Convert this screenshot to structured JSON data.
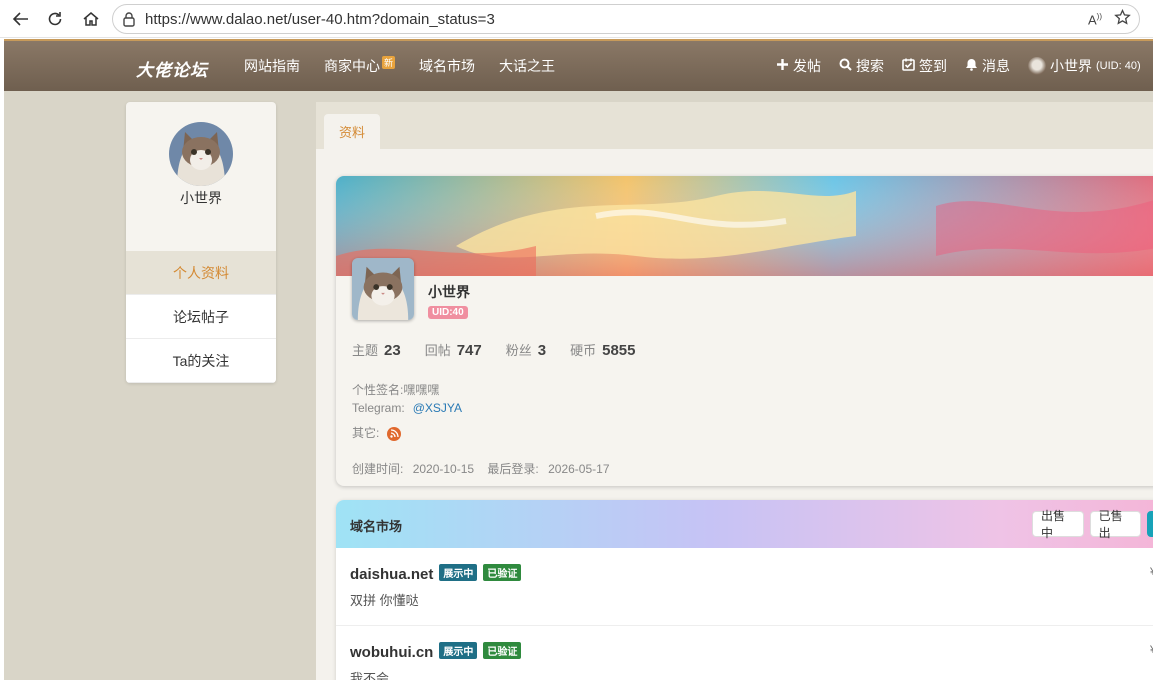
{
  "browser": {
    "url": "https://www.dalao.net/user-40.htm?domain_status=3"
  },
  "site": {
    "logo": "大佬论坛",
    "nav": [
      {
        "label": "网站指南"
      },
      {
        "label": "商家中心",
        "badge": "新"
      },
      {
        "label": "域名市场"
      },
      {
        "label": "大话之王"
      }
    ],
    "actions": {
      "post": "发帖",
      "search": "搜索",
      "checkin": "签到",
      "messages": "消息",
      "user_name": "小世界",
      "user_uid": "(UID: 40)"
    }
  },
  "sidebar": {
    "name": "小世界",
    "menu": [
      {
        "label": "个人资料",
        "active": true
      },
      {
        "label": "论坛帖子",
        "active": false
      },
      {
        "label": "Ta的关注",
        "active": false
      }
    ]
  },
  "tabs": [
    {
      "label": "资料"
    }
  ],
  "profile": {
    "name": "小世界",
    "uid_badge": "UID:40",
    "stats": [
      {
        "label": "主题",
        "value": "23"
      },
      {
        "label": "回帖",
        "value": "747"
      },
      {
        "label": "粉丝",
        "value": "3"
      },
      {
        "label": "硬币",
        "value": "5855"
      }
    ],
    "signature_label": "个性签名:",
    "signature": "嘿嘿嘿",
    "telegram_label": "Telegram:",
    "telegram": "@XSJYA",
    "other_label": "其它:",
    "other_icon": "rss-icon",
    "created_label": "创建时间:",
    "created": "2020-10-15",
    "last_login_label": "最后登录:",
    "last_login": "2026-05-17"
  },
  "domain_market": {
    "title": "域名市场",
    "buttons": [
      "出售中",
      "已售出"
    ],
    "items": [
      {
        "domain": "daishua.net",
        "tags": [
          "展示中",
          "已验证"
        ],
        "desc": "双拼 你懂哒"
      },
      {
        "domain": "wobuhui.cn",
        "tags": [
          "展示中",
          "已验证"
        ],
        "desc": "我不会"
      }
    ]
  },
  "colors": {
    "accent": "#d48a34",
    "nav_bg": "#7d6b59",
    "tag_show": "#1f6f86",
    "tag_verified": "#2f8a3e",
    "uid_badge": "#f08fa0"
  }
}
